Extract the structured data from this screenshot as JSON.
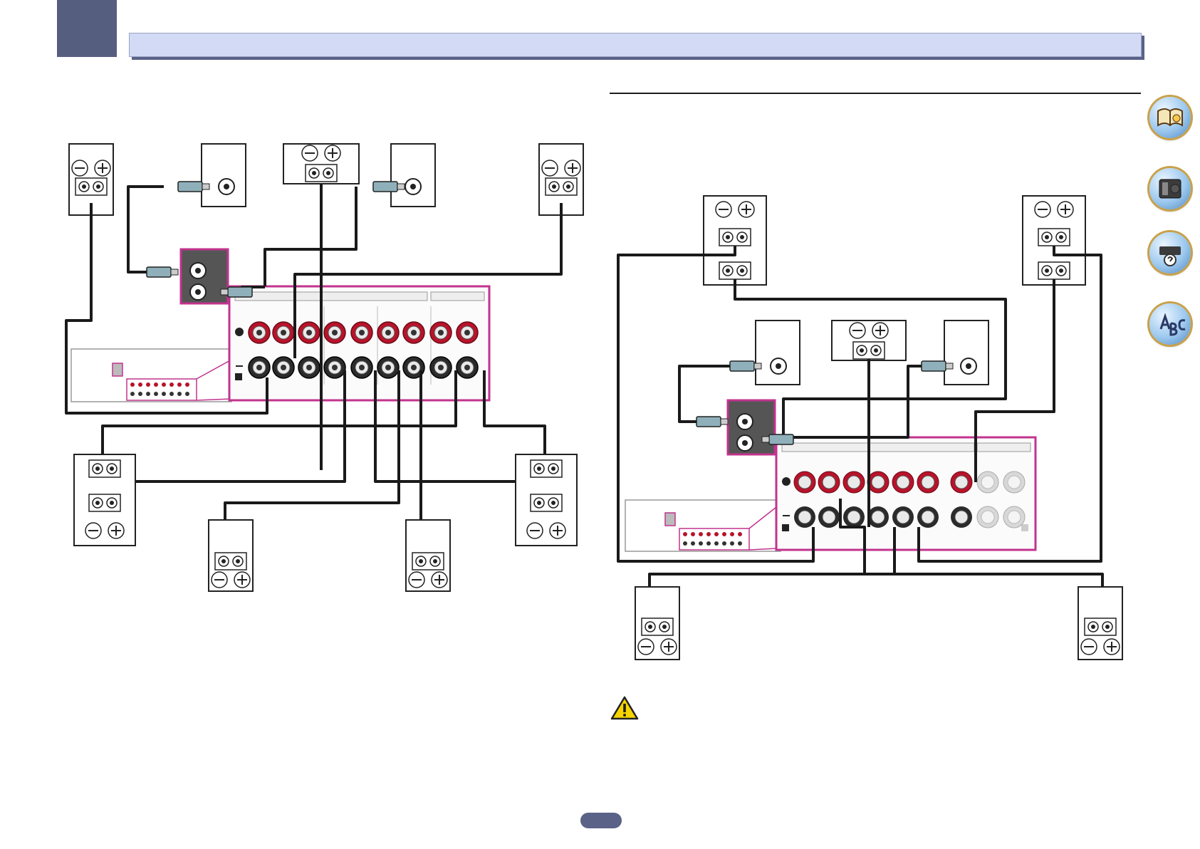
{
  "page": {
    "number": "",
    "footer_code": ""
  },
  "nav": {
    "icons": [
      {
        "name": "manual-icon"
      },
      {
        "name": "remote-icon"
      },
      {
        "name": "faq-icon"
      },
      {
        "name": "glossary-icon"
      }
    ]
  },
  "colors": {
    "highlight": "#c2338e",
    "terminal_red": "#b8132a",
    "cable": "#1a1a1a",
    "header_band": "#d3daf6",
    "chapter_tab": "#565e80",
    "rca_plug": "#8fb0ba"
  },
  "caution": {
    "icon": "warning-triangle-icon"
  },
  "symbols": {
    "plus": "+",
    "minus": "−"
  }
}
